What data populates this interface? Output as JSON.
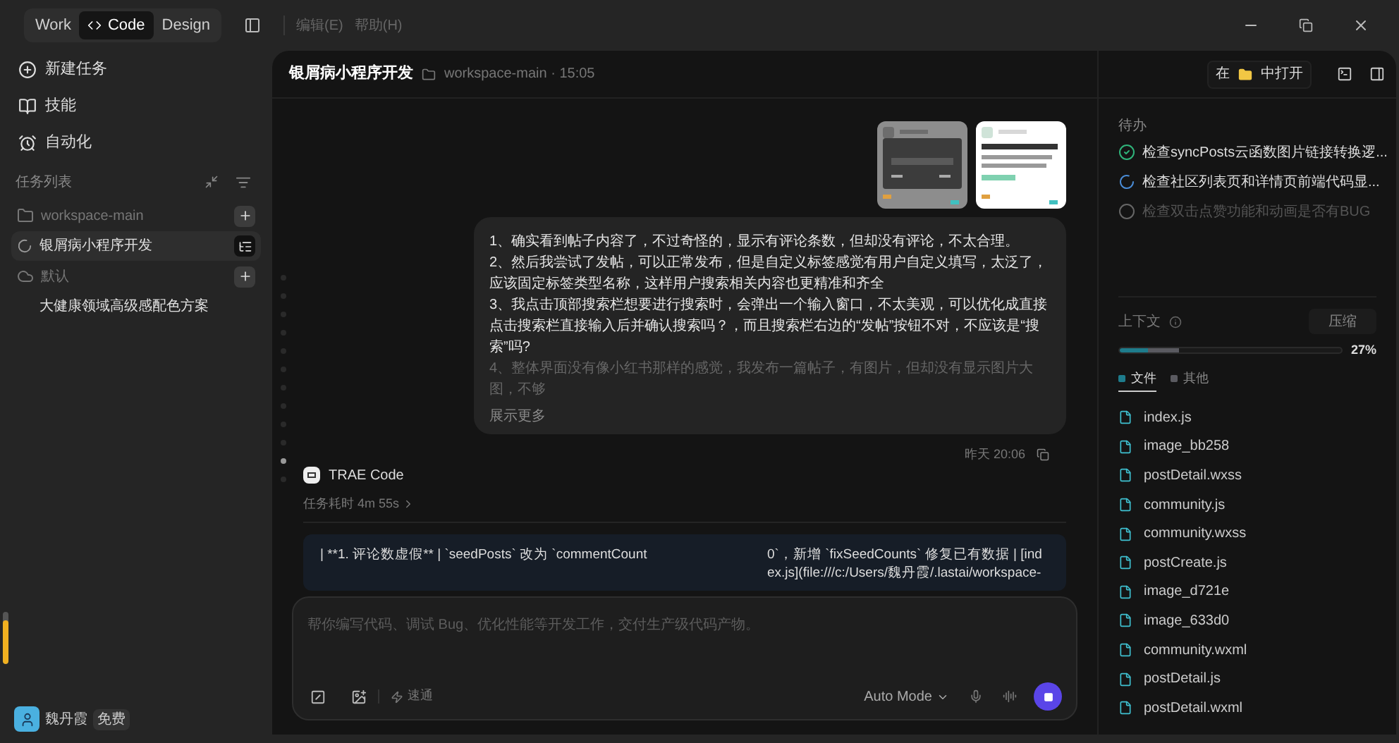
{
  "top_bar": {
    "modes": [
      {
        "label": "Work",
        "selected": false
      },
      {
        "label": "Code",
        "selected": true,
        "kind": "code"
      },
      {
        "label": "Design",
        "selected": false
      }
    ],
    "menu": [
      {
        "label": "编辑(E)",
        "disabled": true
      },
      {
        "label": "帮助(H)",
        "disabled": true
      }
    ]
  },
  "sidebar": {
    "nav": [
      {
        "label": "新建任务",
        "kind": "new"
      },
      {
        "label": "技能",
        "kind": "skills"
      },
      {
        "label": "自动化",
        "kind": "automation"
      }
    ],
    "section_title": "任务列表",
    "groups": [
      {
        "name": "workspace-main",
        "kind": "folder",
        "tasks": [
          {
            "title": "银屑病小程序开发",
            "selected": true,
            "running": true
          }
        ]
      },
      {
        "name": "默认",
        "kind": "cloud",
        "tasks": [
          {
            "title": "大健康领域高级感配色方案",
            "selected": false,
            "running": false
          }
        ]
      }
    ],
    "meter": {
      "level": 0.85
    },
    "user": {
      "name": "魏丹霞",
      "plan": "免费"
    }
  },
  "chat": {
    "title": "银屑病小程序开发",
    "workspace": "workspace-main · 15:05",
    "message": {
      "paragraphs": [
        "1、确实看到帖子内容了，不过奇怪的，显示有评论条数，但却没有评论，不太合理。",
        "2、然后我尝试了发帖，可以正常发布，但是自定义标签感觉有用户自定义填写，太泛了，应该固定标签类型名称，这样用户搜索相关内容也更精准和齐全",
        "3、我点击顶部搜索栏想要进行搜索时，会弹出一个输入窗口，不太美观，可以优化成直接点击搜索栏直接输入后并确认搜索吗？，而且搜索栏右边的“发帖”按钮不对，不应该是“搜索”吗?",
        "4、整体界面没有像小红书那样的感觉，我发布一篇帖子，有图片，但却没有显示图片大图，不够"
      ],
      "show_more": "展示更多",
      "time": "昨天 20:06"
    },
    "agent": "TRAE Code",
    "duration": "任务耗时 4m 55s",
    "card": {
      "left": "| **1. 评论数虚假** | `seedPosts` 改为 `commentCount",
      "right": "0`，新增 `fixSeedCounts` 修复已有数据 | [index.js](file:///c:/Users/魏丹霞/.lastai/workspace-"
    },
    "input": {
      "placeholder": "帮你编写代码、调试 Bug、优化性能等开发工作，交付生产级代码产物。",
      "speed": "速通",
      "mode": "Auto Mode"
    }
  },
  "right_panel": {
    "open_in": {
      "before": "在",
      "after": "中打开"
    },
    "todo_title": "待办",
    "todos": [
      {
        "text": "检查syncPosts云函数图片链接转换逻...",
        "kind": "done"
      },
      {
        "text": "检查社区列表页和详情页前端代码显...",
        "kind": "in_progress"
      },
      {
        "text": "检查双击点赞功能和动画是否有BUG",
        "kind": "pending"
      }
    ],
    "context": {
      "title": "上下文",
      "compress": "压缩",
      "percent": "27%",
      "segments": [
        {
          "label": "文件",
          "color": "#1e7c8c",
          "level": 0.13,
          "selected": true
        },
        {
          "label": "其他",
          "color": "#5a5a60",
          "level": 0.14,
          "selected": false
        }
      ]
    },
    "files": [
      "index.js",
      "image_bb258",
      "postDetail.wxss",
      "community.js",
      "community.wxss",
      "postCreate.js",
      "image_d721e",
      "image_633d0",
      "community.wxml",
      "postDetail.js",
      "postDetail.wxml"
    ]
  }
}
